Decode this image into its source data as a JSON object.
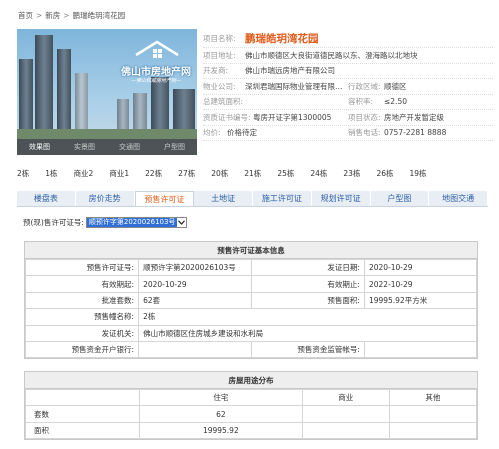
{
  "breadcrumb": [
    "首页",
    "新房",
    "鹏瑞皓玥湾花园"
  ],
  "hero": {
    "logo_title": "佛山市房地产网",
    "logo_sub": "—佛山权威房地产网—",
    "tabs": [
      "效果图",
      "实景图",
      "交通图",
      "户型图"
    ]
  },
  "project": {
    "name_label": "项目名称:",
    "name": "鹏瑞皓玥湾花园",
    "address_label": "项目地址:",
    "address": "佛山市顺德区大良街道德民路以东、澄海路以北地块",
    "developer_label": "开发商:",
    "developer": "佛山市瑞远房地产有限公司",
    "property_label": "物业公司:",
    "property": "深圳君瑞国际物业管理有限公...",
    "district_label": "行政区域:",
    "district": "顺德区",
    "area_label": "总建筑面积:",
    "area": "",
    "plot_label": "容积率:",
    "plot": "≤2.50",
    "cert_label": "资质证书编号:",
    "cert": "粤房开证字第1300005",
    "status_label": "项目状态:",
    "status": "房地产开发暂定级",
    "price_label": "均价:",
    "price": "价格待定",
    "phone_label": "销售电话:",
    "phone": "0757-2281 8888"
  },
  "buildings": [
    "2栋",
    "1栋",
    "商业2",
    "商业1",
    "22栋",
    "27栋",
    "20栋",
    "21栋",
    "25栋",
    "24栋",
    "23栋",
    "26栋",
    "19栋"
  ],
  "nav_tabs": [
    "楼盘表",
    "房价走势",
    "预售许可证",
    "土地证",
    "施工许可证",
    "规划许可证",
    "户型图",
    "地图交通"
  ],
  "active_tab": "预售许可证",
  "permit_select": {
    "label": "预(现)售许可证号:",
    "value": "顺预许字第2020026103号"
  },
  "permit_info": {
    "header": "预售许可证基本信息",
    "rows": [
      [
        "预售许可证号:",
        "顺预许字第2020026103号",
        "发证日期:",
        "2020-10-29"
      ],
      [
        "有效期起:",
        "2020-10-29",
        "有效期止:",
        "2022-10-29"
      ],
      [
        "批准套数:",
        "62套",
        "预售面积:",
        "19995.92平方米"
      ],
      [
        "预售幢名称:",
        "2栋",
        "",
        ""
      ],
      [
        "发证机关:",
        "佛山市顺德区住房城乡建设和水利局",
        "",
        ""
      ],
      [
        "预售资金开户银行:",
        "",
        "预售资金监管帐号:",
        ""
      ]
    ]
  },
  "usage": {
    "header": "房屋用途分布",
    "columns": [
      "",
      "住宅",
      "商业",
      "其他"
    ],
    "rows": [
      [
        "套数",
        "62",
        "",
        ""
      ],
      [
        "面积",
        "19995.92",
        "",
        ""
      ]
    ]
  }
}
